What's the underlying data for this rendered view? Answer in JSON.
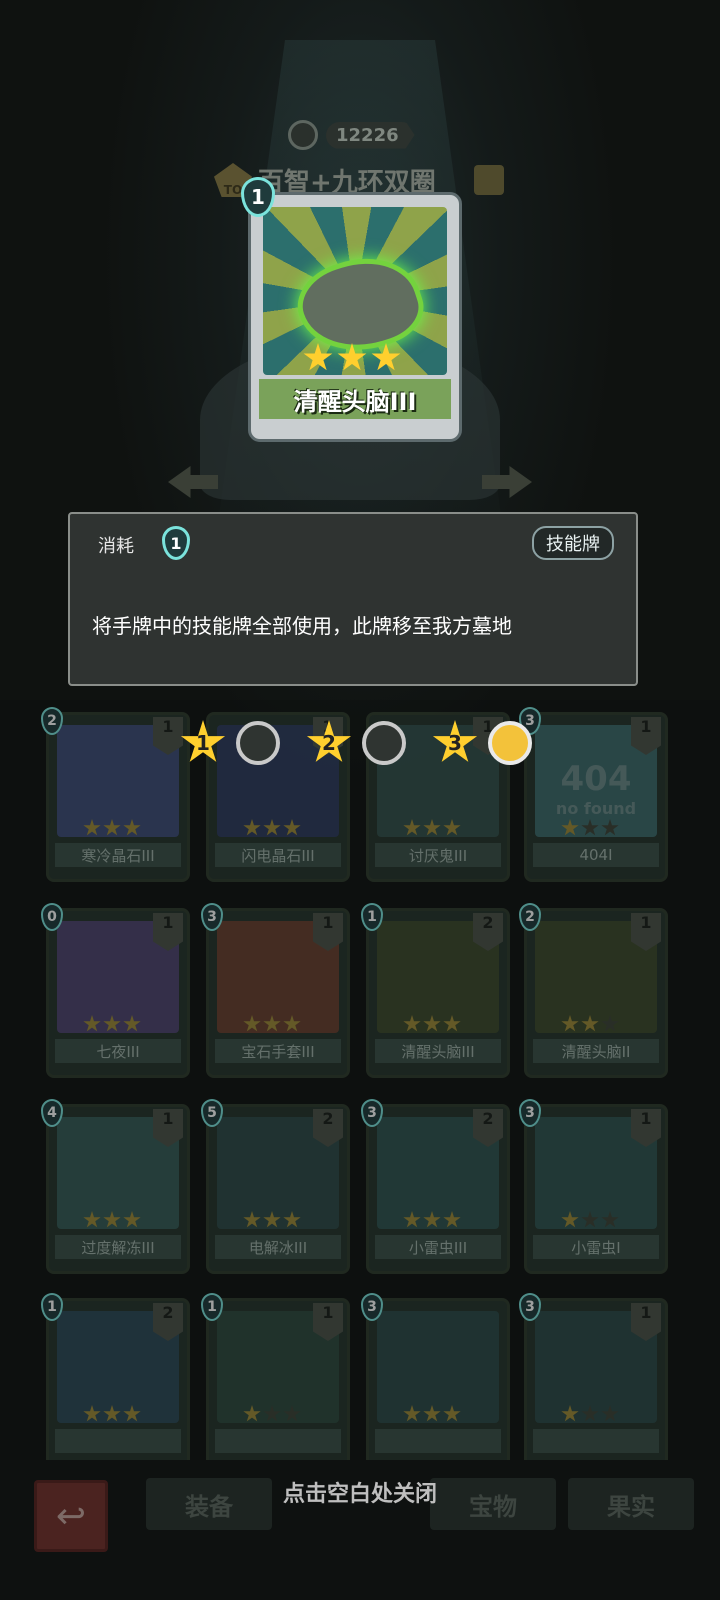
{
  "header": {
    "power_value": "12226",
    "deck_level": "TO",
    "deck_name": "百智+九环双圈"
  },
  "featured_card": {
    "cost": "1",
    "name": "清醒头脑III",
    "stars": 3
  },
  "tooltip": {
    "cost_label": "消耗",
    "cost_value": "1",
    "type_tag": "技能牌",
    "description": "将手牌中的技能牌全部使用，此牌移至我方墓地"
  },
  "star_selector": [
    {
      "label": "1",
      "selected": false
    },
    {
      "label": "2",
      "selected": false
    },
    {
      "label": "3",
      "selected": true
    }
  ],
  "cards": [
    {
      "name": "寒冷晶石III",
      "cost": "2",
      "qty": "1",
      "stars": 3,
      "art_color": "#3e4c78"
    },
    {
      "name": "闪电晶石III",
      "cost": "",
      "qty": "1",
      "stars": 3,
      "art_color": "#2d3b5e"
    },
    {
      "name": "讨厌鬼III",
      "cost": "",
      "qty": "1",
      "stars": 3,
      "art_color": "#32504c"
    },
    {
      "name": "404I",
      "cost": "3",
      "qty": "1",
      "stars": 1,
      "art_color": "#3d6a6c",
      "art_text": "404",
      "art_sub": "no found"
    },
    {
      "name": "七夜III",
      "cost": "0",
      "qty": "1",
      "stars": 3,
      "art_color": "#4e4570"
    },
    {
      "name": "宝石手套III",
      "cost": "3",
      "qty": "1",
      "stars": 3,
      "art_color": "#6a4030"
    },
    {
      "name": "清醒头脑III",
      "cost": "1",
      "qty": "2",
      "stars": 3,
      "art_color": "#3d4a2c"
    },
    {
      "name": "清醒头脑II",
      "cost": "2",
      "qty": "1",
      "stars": 2,
      "art_color": "#3d4a2c"
    },
    {
      "name": "过度解冻III",
      "cost": "4",
      "qty": "1",
      "stars": 3,
      "art_color": "#355c58"
    },
    {
      "name": "电解冰III",
      "cost": "5",
      "qty": "2",
      "stars": 3,
      "art_color": "#2e4a48"
    },
    {
      "name": "小雷虫III",
      "cost": "3",
      "qty": "2",
      "stars": 3,
      "art_color": "#2f5450"
    },
    {
      "name": "小雷虫I",
      "cost": "3",
      "qty": "1",
      "stars": 1,
      "art_color": "#2f5450"
    },
    {
      "name": "",
      "cost": "1",
      "qty": "2",
      "stars": 3,
      "art_color": "#2c4a58"
    },
    {
      "name": "",
      "cost": "1",
      "qty": "1",
      "stars": 1,
      "art_color": "#2d4a3e"
    },
    {
      "name": "",
      "cost": "3",
      "qty": "",
      "stars": 3,
      "art_color": "#2c4a48"
    },
    {
      "name": "",
      "cost": "3",
      "qty": "1",
      "stars": 1,
      "art_color": "#2c4a48"
    }
  ],
  "bottom": {
    "back_icon": "↩",
    "tabs": [
      "装备",
      "宝物",
      "果实"
    ],
    "close_hint": "点击空白处关闭"
  }
}
